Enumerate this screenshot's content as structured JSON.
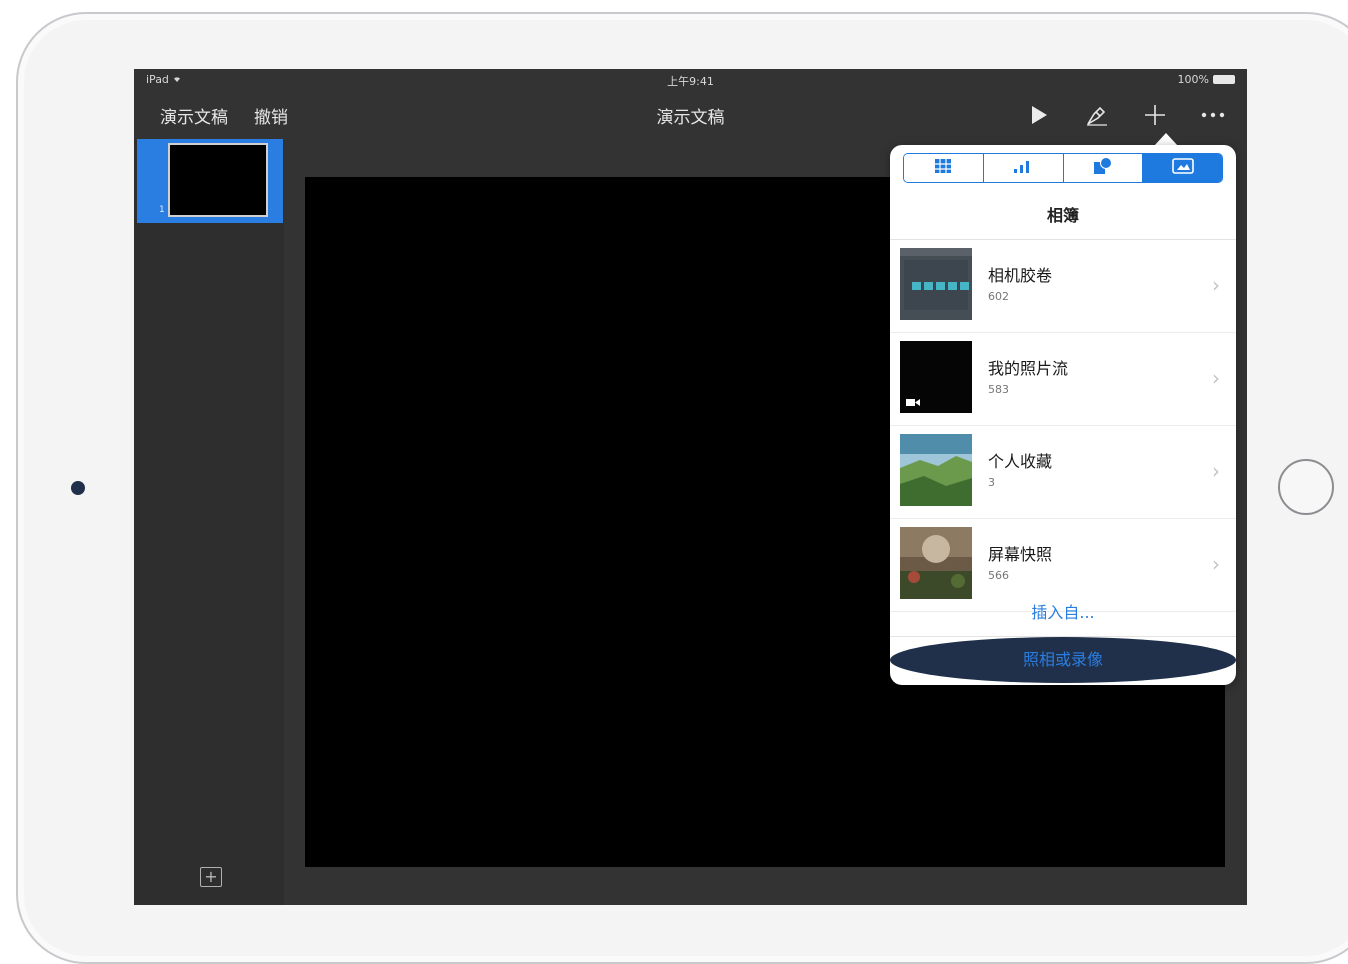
{
  "status_bar": {
    "device": "iPad",
    "time": "上午9:41",
    "battery": "100%"
  },
  "nav": {
    "back_label": "演示文稿",
    "undo_label": "撤销",
    "title": "演示文稿",
    "icons": [
      "play-icon",
      "format-brush-icon",
      "plus-icon",
      "more-icon"
    ]
  },
  "sidebar": {
    "slides": [
      {
        "number": "1"
      }
    ]
  },
  "popover": {
    "tabs": [
      "table-icon",
      "chart-icon",
      "shapes-icon",
      "media-icon"
    ],
    "active_tab": 3,
    "header": "相簿",
    "albums": [
      {
        "title": "相机胶卷",
        "count": "602"
      },
      {
        "title": "我的照片流",
        "count": "583"
      },
      {
        "title": "个人收藏",
        "count": "3"
      },
      {
        "title": "屏幕快照",
        "count": "566"
      }
    ],
    "insert_from": "插入自...",
    "take_photo": "照相或录像"
  },
  "colors": {
    "accent": "#1f7ae0",
    "screen_bg": "#333333",
    "slide_bg": "#000000"
  }
}
